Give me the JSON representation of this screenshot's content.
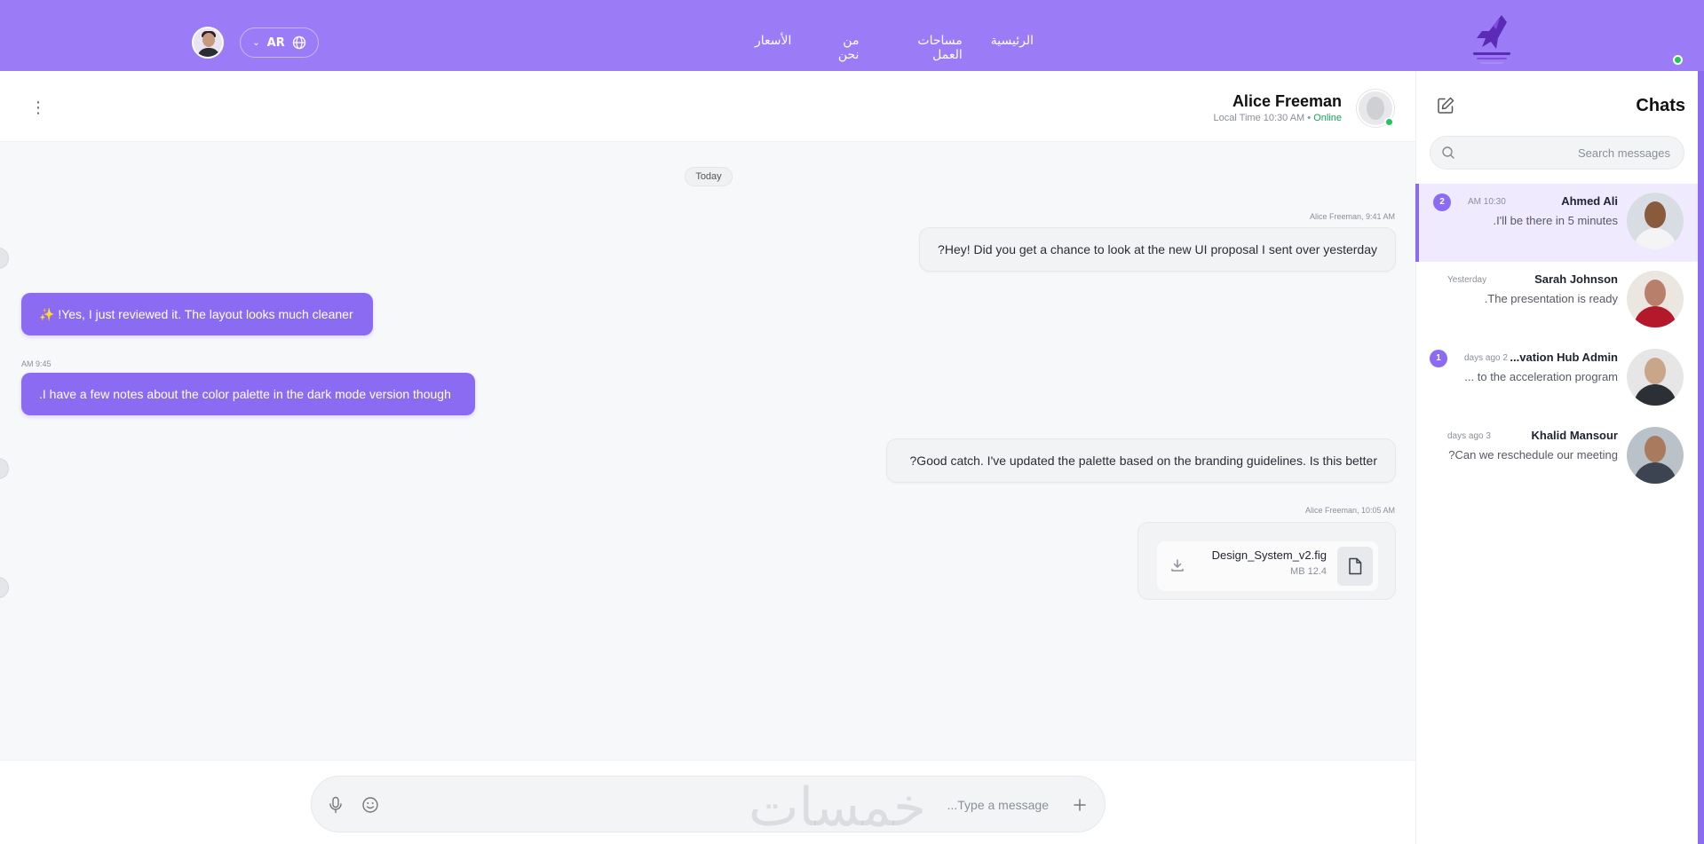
{
  "topnav": {
    "lang_code": "AR",
    "links": [
      "الرئيسية",
      "مساحات العمل",
      "من نحن",
      "الأسعار"
    ],
    "brand_color": "#9b7cf6"
  },
  "chat_header": {
    "name": "Alice Freeman",
    "local_time": "Local Time 10:30 AM •",
    "status": "Online"
  },
  "messages": {
    "date_divider": "Today",
    "m1_meta": "Alice Freeman, 9:41 AM",
    "m1_text": "?Hey! Did you get a chance to look at the new UI proposal I sent over yesterday",
    "m2_text": "✨ !Yes, I just reviewed it. The layout looks much cleaner",
    "m3_meta": "AM 9:45",
    "m3_text": ".I have a few notes about the color palette in the dark mode version though",
    "m4_text": "?Good catch. I've updated the palette based on the branding guidelines. Is this better",
    "m5_meta": "Alice Freeman, 10:05 AM",
    "file_name": "Design_System_v2.fig",
    "file_size": "MB 12.4"
  },
  "composer": {
    "placeholder": "...Type a message"
  },
  "sidebar": {
    "title": "Chats",
    "search_placeholder": "Search messages",
    "chats": [
      {
        "name": "Ahmed Ali",
        "preview": ".I'll be there in 5 minutes",
        "time": "AM 10:30",
        "badge": "2"
      },
      {
        "name": "Sarah Johnson",
        "preview": ".The presentation is ready",
        "time": "Yesterday",
        "badge": ""
      },
      {
        "name": "...vation Hub Admin",
        "preview": "... to the acceleration program",
        "time": "days ago 2",
        "badge": "1"
      },
      {
        "name": "Khalid Mansour",
        "preview": "?Can we reschedule our meeting",
        "time": "days ago 3",
        "badge": ""
      }
    ]
  },
  "watermark": "خمسات",
  "colors": {
    "accent": "#8b6bf2",
    "online": "#22c55e"
  }
}
